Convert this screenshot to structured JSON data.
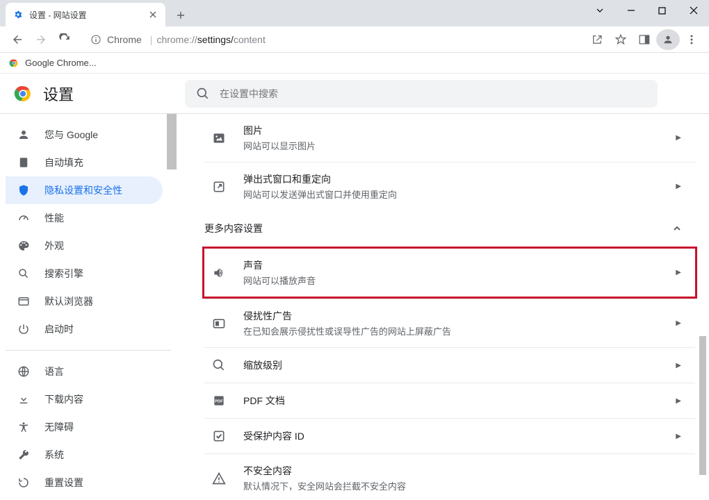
{
  "tab": {
    "title": "设置 - 网站设置"
  },
  "url": {
    "scheme_label": "Chrome",
    "host": "chrome://",
    "path1": "settings/",
    "path2": "content"
  },
  "bookmark": {
    "label": "Google Chrome..."
  },
  "header": {
    "title": "设置",
    "search_placeholder": "在设置中搜索"
  },
  "sidebar": {
    "items": [
      {
        "label": "您与 Google"
      },
      {
        "label": "自动填充"
      },
      {
        "label": "隐私设置和安全性"
      },
      {
        "label": "性能"
      },
      {
        "label": "外观"
      },
      {
        "label": "搜索引擎"
      },
      {
        "label": "默认浏览器"
      },
      {
        "label": "启动时"
      }
    ],
    "items2": [
      {
        "label": "语言"
      },
      {
        "label": "下载内容"
      },
      {
        "label": "无障碍"
      },
      {
        "label": "系统"
      },
      {
        "label": "重置设置"
      }
    ]
  },
  "content": {
    "rows_top": [
      {
        "title": "图片",
        "sub": "网站可以显示图片"
      },
      {
        "title": "弹出式窗口和重定向",
        "sub": "网站可以发送弹出式窗口并使用重定向"
      }
    ],
    "section_title": "更多内容设置",
    "rows_more": [
      {
        "title": "声音",
        "sub": "网站可以播放声音"
      },
      {
        "title": "侵扰性广告",
        "sub": "在已知会展示侵扰性或误导性广告的网站上屏蔽广告"
      },
      {
        "title": "缩放级别",
        "sub": ""
      },
      {
        "title": "PDF 文档",
        "sub": ""
      },
      {
        "title": "受保护内容 ID",
        "sub": ""
      },
      {
        "title": "不安全内容",
        "sub": "默认情况下，安全网站会拦截不安全内容"
      }
    ]
  }
}
